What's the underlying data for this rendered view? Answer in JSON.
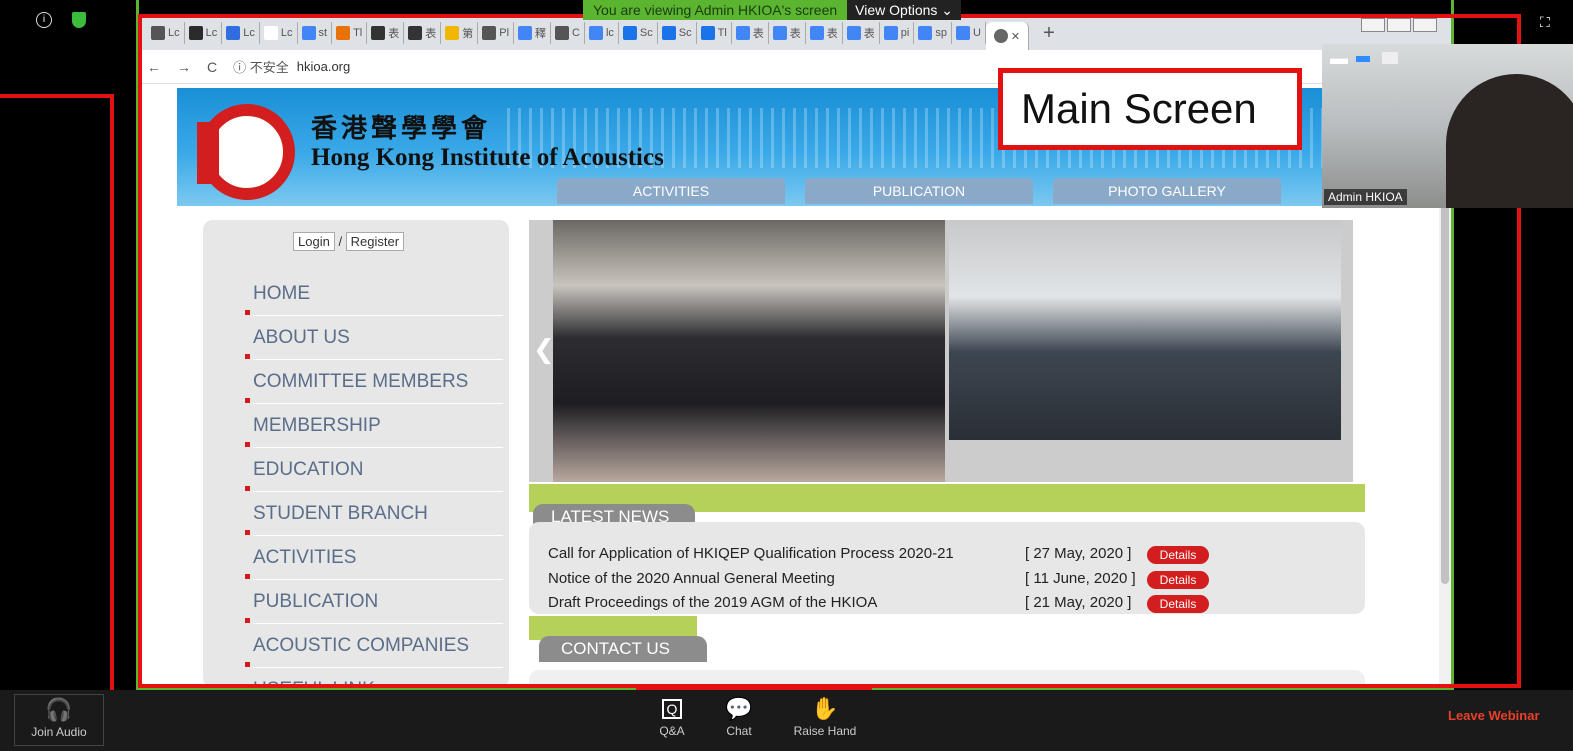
{
  "banner": {
    "message": "You are viewing Admin HKIOA's screen",
    "options": "View Options"
  },
  "tabs": [
    "Lc",
    "Lc",
    "Lc",
    "Lc",
    "st",
    "Tl",
    "表",
    "表",
    "第",
    "Pl",
    "釋",
    "C",
    "lc",
    "Sc",
    "Sc",
    "Tl",
    "表",
    "表",
    "表",
    "表",
    "pi",
    "sp",
    "U"
  ],
  "tab_favicon_colors": [
    "#555",
    "#2b2b2b",
    "#2f6de1",
    "#fff",
    "#4285f4",
    "#e8710a",
    "#333",
    "#333",
    "#f2b705",
    "#555",
    "#4285f4",
    "#555",
    "#4285f4",
    "#1a73e8",
    "#1a73e8",
    "#1a73e8",
    "#4285f4",
    "#4285f4",
    "#4285f4",
    "#4285f4",
    "#4285f4",
    "#4285f4",
    "#4285f4"
  ],
  "addressbar": {
    "back": "←",
    "forward": "→",
    "reload": "C",
    "security": "ⓘ 不安全",
    "url": "hkioa.org"
  },
  "site": {
    "title_cn": "香港聲學學會",
    "title_en": "Hong Kong Institute of Acoustics",
    "nav": [
      "ACTIVITIES",
      "PUBLICATION",
      "PHOTO GALLERY"
    ],
    "login": "Login",
    "register": "Register",
    "menu": [
      "HOME",
      "ABOUT US",
      "COMMITTEE MEMBERS",
      "MEMBERSHIP",
      "EDUCATION",
      "STUDENT BRANCH",
      "ACTIVITIES",
      "PUBLICATION",
      "ACOUSTIC COMPANIES",
      "USEFUL LINK"
    ],
    "latest_news_title": "LATEST NEWS",
    "news": [
      {
        "title": "Call for Application of HKIQEP Qualification Process 2020-21",
        "date": "[ 27 May, 2020 ]",
        "link": "Details"
      },
      {
        "title": "Notice of the 2020 Annual General Meeting",
        "date": "[ 11 June, 2020 ]",
        "link": "Details"
      },
      {
        "title": "Draft Proceedings of the 2019 AGM of the HKIOA",
        "date": "[ 21 May, 2020 ]",
        "link": "Details"
      }
    ],
    "contact_title": "CONTACT US"
  },
  "annotation": {
    "main_screen": "Main Screen"
  },
  "video": {
    "participant_name": "Admin HKIOA"
  },
  "controls": {
    "join_audio": "Join Audio",
    "qa": "Q&A",
    "chat": "Chat",
    "raise_hand": "Raise Hand",
    "leave": "Leave Webinar"
  },
  "colors": {
    "accent_red": "#e31111",
    "zoom_green": "#5cb531",
    "site_blue": "#1a8fd6",
    "news_green": "#b5d15a",
    "details_red": "#d21e1e"
  }
}
